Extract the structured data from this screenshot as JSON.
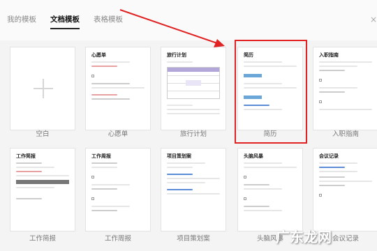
{
  "tabs": [
    {
      "label": "我的模板",
      "active": false
    },
    {
      "label": "文档模板",
      "active": true
    },
    {
      "label": "表格模板",
      "active": false
    }
  ],
  "close_icon": "×",
  "templates_row1": [
    {
      "title": "",
      "caption": "空白"
    },
    {
      "title": "心愿单",
      "caption": "心愿单"
    },
    {
      "title": "旅行计划",
      "caption": "旅行计划"
    },
    {
      "title": "简历",
      "caption": "简历"
    },
    {
      "title": "入职指南",
      "caption": "入职指南"
    }
  ],
  "templates_row2": [
    {
      "title": "工作简报",
      "caption": "工作简报"
    },
    {
      "title": "工作周报",
      "caption": "工作周报"
    },
    {
      "title": "项目策划案",
      "caption": "项目策划案"
    },
    {
      "title": "头脑风暴",
      "caption": "头脑风暴"
    },
    {
      "title": "会议记录",
      "caption": "会议记录"
    }
  ],
  "colors": {
    "highlight": "#e02222",
    "accent_blue": "#5b8bd6",
    "table_header": "#b3a6d8"
  },
  "watermark": "广东龙网"
}
